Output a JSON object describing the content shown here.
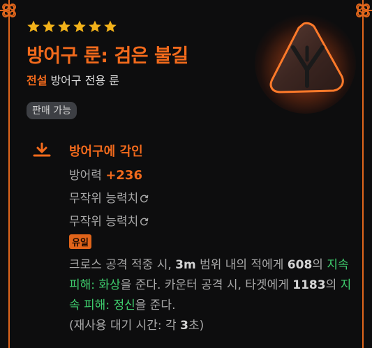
{
  "item": {
    "star_count": 6,
    "title": "방어구 룬: 검은 불길",
    "grade": "전설",
    "type_desc": "방어구 전용 룬",
    "trade_badge": "판매 가능",
    "rune_icon": "dark-flame-rune-icon"
  },
  "engrave": {
    "icon": "engrave-download-icon",
    "title": "방어구에 각인",
    "stat_name": "방어력",
    "stat_value": "+236",
    "random_stat_1": "무작위 능력치",
    "random_stat_2": "무작위 능력치",
    "unique_label": "유일"
  },
  "effect": {
    "p1": "크로스 공격 적중 시, ",
    "range": "3m",
    "p2": " 범위 내의 적에게 ",
    "dmg1": "608",
    "p3": "의 ",
    "dot1": "지속 피해: 화상",
    "p4": "을 준다. 카운터 공격 시, 타겟에게 ",
    "dmg2": "1183",
    "p5": "의 ",
    "dot2": "지속 피해: 정신",
    "p6": "을 준다.",
    "p7": "(재사용 대기 시간: 각 ",
    "cooldown": "3",
    "p8": "초)"
  },
  "colors": {
    "accent": "#f26a1c",
    "frame": "#e0661c",
    "star": "#f2b21a",
    "effect_green": "#3fcf6e",
    "badge_bg": "#3d3f44"
  }
}
